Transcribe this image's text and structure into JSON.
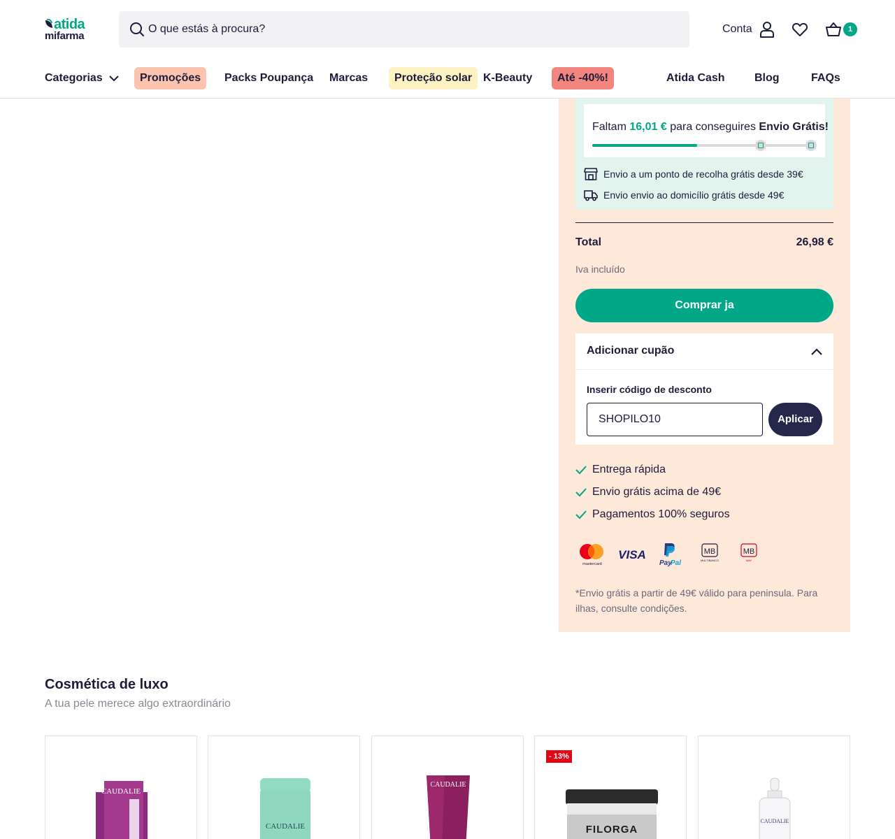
{
  "header": {
    "logo_top": "atida",
    "logo_bottom": "mifarma",
    "search_placeholder": "O que estás à procura?",
    "account_label": "Conta",
    "cart_count": "1"
  },
  "nav": {
    "categories": "Categorias",
    "items": [
      "Promoções",
      "Packs Poupança",
      "Marcas",
      "Proteção solar",
      "K-Beauty",
      "Até -40%!",
      "Atida Cash",
      "Blog",
      "FAQs"
    ]
  },
  "shipping": {
    "prefix": "Faltam",
    "amount": "16,01 €",
    "middle": "para conseguires",
    "goal": "Envio Grátis!",
    "progress": 0.47,
    "pickup": "Envio a um  ponto de recolha grátis  desde 39€",
    "home": "Envio  envio ao domicílio grátis  desde 49€"
  },
  "summary": {
    "total_label": "Total",
    "total_value": "26,98 €",
    "vat_note": "Iva incluído",
    "buy_button": "Comprar ja"
  },
  "coupon": {
    "title": "Adicionar cupão",
    "label": "Inserir código de desconto",
    "value": "SHOPILO10",
    "apply_button": "Aplicar"
  },
  "benefits": [
    "Entrega rápida",
    "Envio grátis acima de 49€",
    "Pagamentos 100% seguros"
  ],
  "payment_methods": {
    "mastercard": "mastercard",
    "visa": "VISA",
    "paypal_1": "Pay",
    "paypal_2": "Pal",
    "mb": "MB",
    "mb_sub": "MULTIBANCO",
    "mbway": "MB",
    "mbway_sub": "WAY"
  },
  "footnote": "*Envio grátis a partir de 49€ válido para peninsula. Para ilhas, consulte condições.",
  "luxury": {
    "title": "Cosmética de luxo",
    "subtitle": "A tua pele merece algo extraordinário",
    "products": [
      {
        "brand": "CAUDALIE",
        "discount": ""
      },
      {
        "brand": "CAUDALIE",
        "discount": ""
      },
      {
        "brand": "CAUDALIE",
        "discount": ""
      },
      {
        "brand": "FILORGA",
        "discount": "- 13%"
      },
      {
        "brand": "CAUDALIE",
        "discount": ""
      }
    ]
  },
  "colors": {
    "brand_green": "#00a887",
    "navy": "#1d1d3b",
    "panel_bg": "#fde8da",
    "shipping_bg": "#e3f3ee",
    "promo_pill": "#fcc3ae",
    "sun_pill": "#fdf3c2",
    "sale_pill": "#f2857d"
  }
}
